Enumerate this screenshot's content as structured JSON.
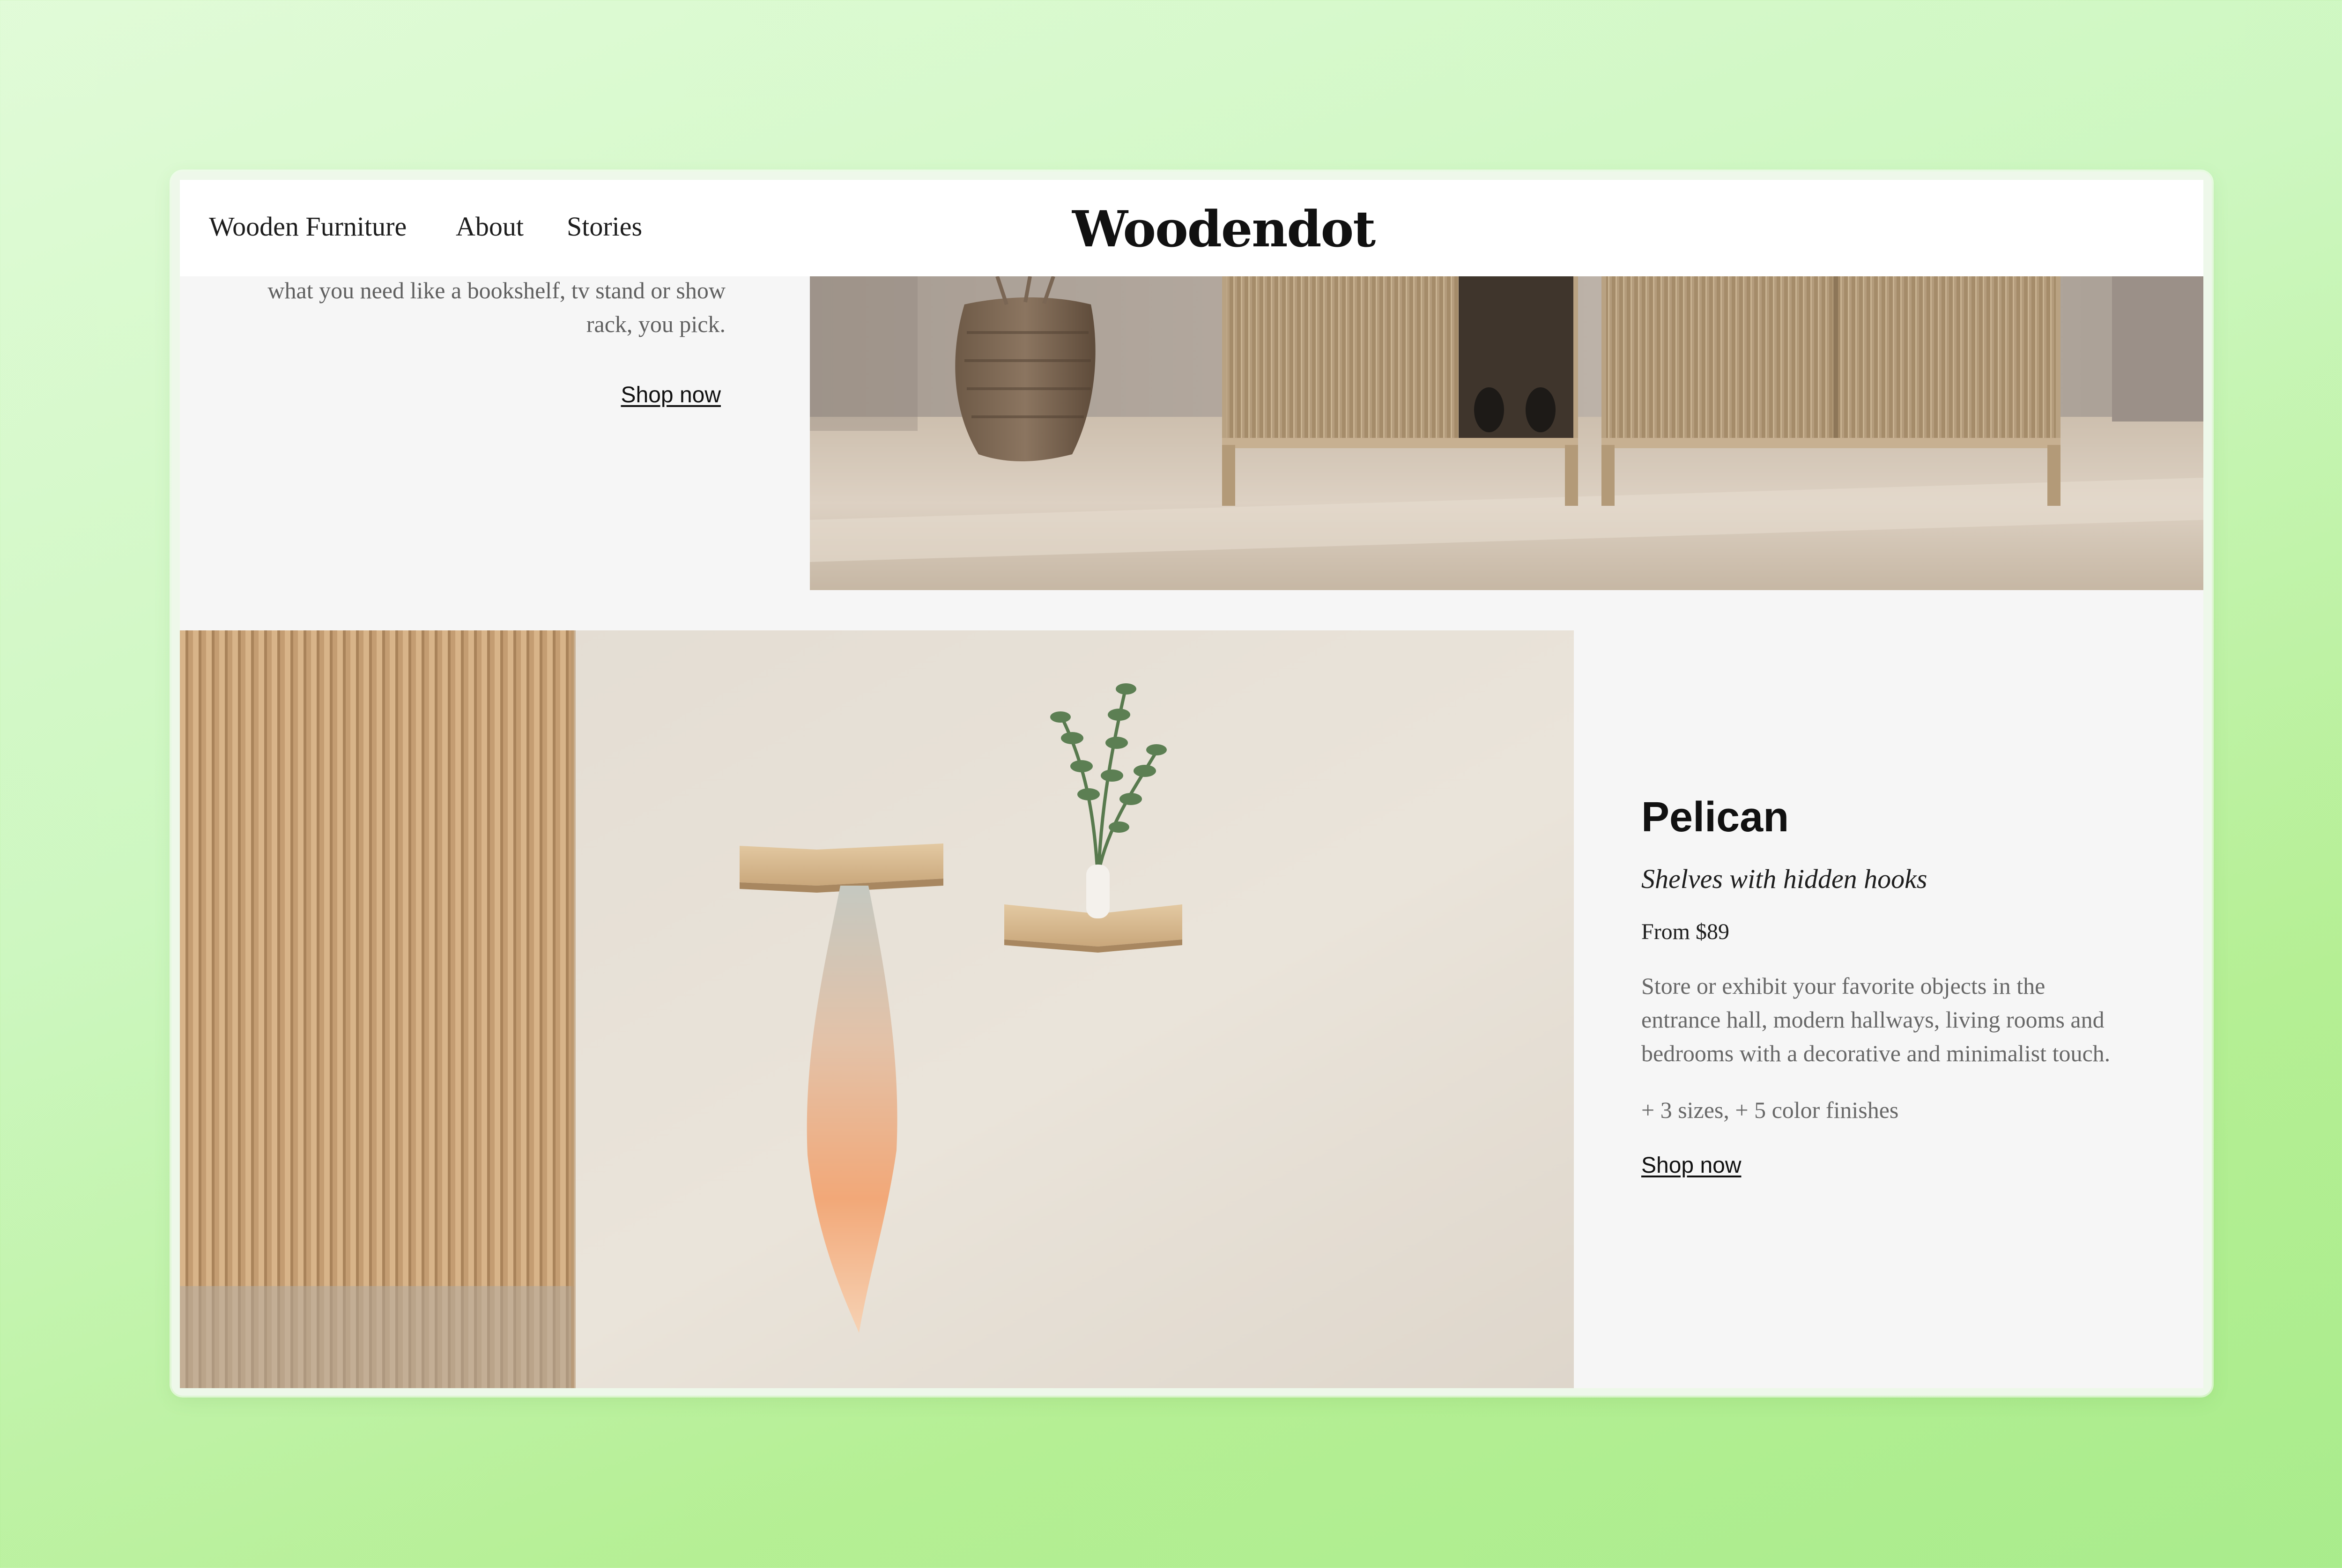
{
  "header": {
    "nav": [
      {
        "label": "Wooden Furniture"
      },
      {
        "label": "About"
      },
      {
        "label": "Stories"
      }
    ],
    "logo": "Woodendot"
  },
  "top_section": {
    "description_lines": [
      "what you need like a bookshelf, tv stand or show",
      "rack, you pick."
    ],
    "shop_label": "Shop now"
  },
  "product": {
    "title": "Pelican",
    "subtitle": "Shelves with hidden hooks",
    "price": "From $89",
    "description_lines": [
      "Store or exhibit your favorite objects in the",
      "entrance hall, modern hallways, living rooms and",
      "bedrooms with a decorative and minimalist touch."
    ],
    "variants": "+ 3 sizes, + 5 color finishes",
    "shop_label": "Shop now"
  },
  "colors": {
    "page_background": "#c8f5b4",
    "content_background": "#f6f6f6",
    "header_background": "#ffffff",
    "wood": "#c9a679"
  },
  "icons": [
    "woodendot-logo"
  ]
}
